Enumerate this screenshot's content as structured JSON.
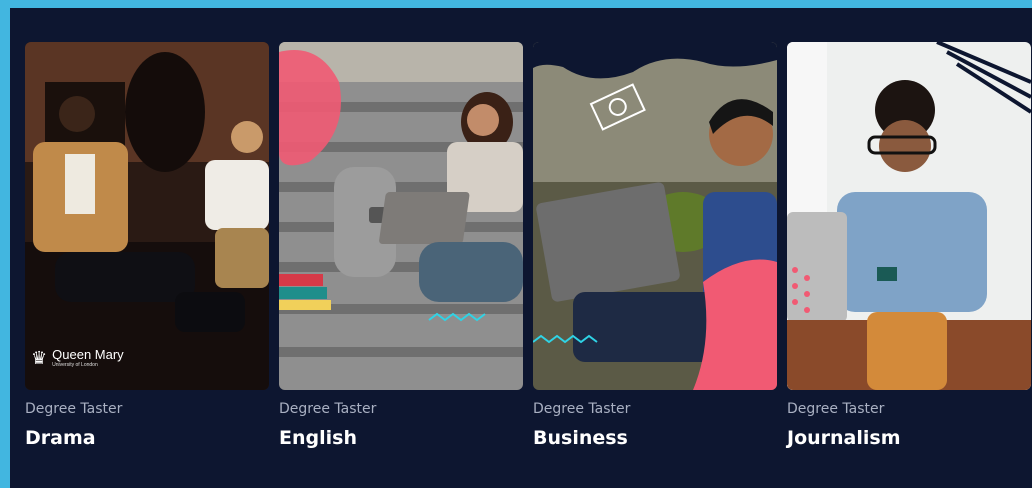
{
  "cards": [
    {
      "kicker": "Degree Taster",
      "title": "Drama",
      "logo": {
        "name": "Queen Mary",
        "sub": "University of London",
        "icon": "crown-icon"
      }
    },
    {
      "kicker": "Degree Taster",
      "title": "English"
    },
    {
      "kicker": "Degree Taster",
      "title": "Business"
    },
    {
      "kicker": "Degree Taster",
      "title": "Journalism"
    }
  ],
  "colors": {
    "page_border": "#42b6e0",
    "panel_bg": "#0d1630",
    "kicker_text": "#a9b0c2",
    "title_text": "#ffffff",
    "accent_pink": "#f15a73",
    "accent_cyan": "#2fd3e5"
  }
}
